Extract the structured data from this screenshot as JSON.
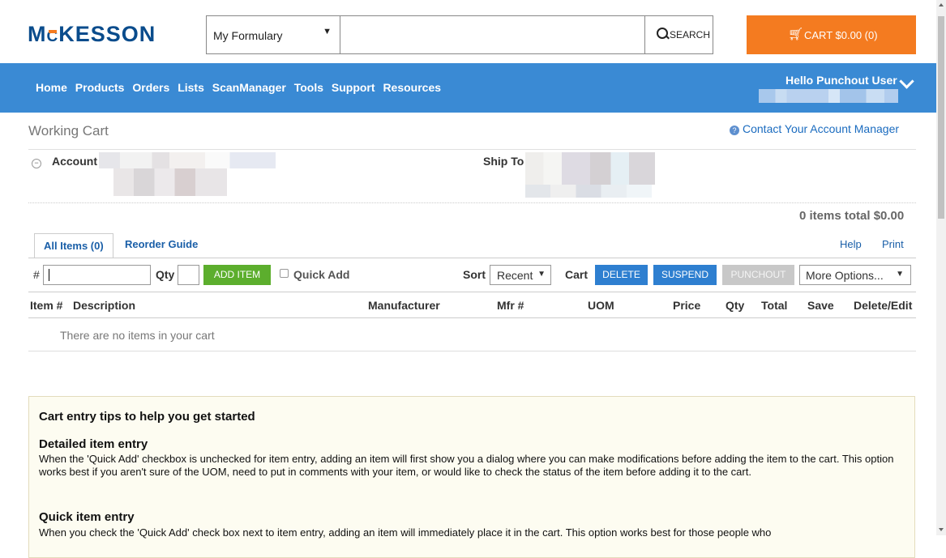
{
  "header": {
    "logo": "MCKESSON",
    "logo_parts": [
      "M",
      "C",
      "KESSON"
    ],
    "formulary_select": "My Formulary",
    "search_placeholder": "",
    "search_label": "SEARCH",
    "cart_label": "CART $0.00 (0)"
  },
  "nav": {
    "items": [
      "Home",
      "Products",
      "Orders",
      "Lists",
      "ScanManager",
      "Tools",
      "Support",
      "Resources"
    ],
    "greeting": "Hello Punchout User"
  },
  "page": {
    "title": "Working Cart",
    "contact_link": "Contact Your Account Manager",
    "account_label": "Account",
    "ship_to_label": "Ship To",
    "items_total": "0 items total $0.00"
  },
  "tabs": {
    "all_items": "All Items (0)",
    "reorder_guide": "Reorder Guide",
    "help": "Help",
    "print": "Print"
  },
  "toolbar": {
    "hash_label": "#",
    "qty_label": "Qty",
    "add_item": "ADD ITEM",
    "quick_add": "Quick Add",
    "sort_label": "Sort",
    "sort_value": "Recent",
    "cart_label": "Cart",
    "delete": "DELETE",
    "suspend": "SUSPEND",
    "punchout": "PUNCHOUT",
    "more_options": "More Options..."
  },
  "table": {
    "columns": [
      "Item #",
      "Description",
      "Manufacturer",
      "Mfr #",
      "UOM",
      "Price",
      "Qty",
      "Total",
      "Save",
      "Delete/Edit"
    ],
    "empty_message": "There are no items in your cart"
  },
  "tips": {
    "title": "Cart entry tips to help you get started",
    "detailed_heading": "Detailed item entry",
    "detailed_text": "When the 'Quick Add' checkbox is unchecked for item entry, adding an item will first show you a dialog where you can make modifications before adding the item to the cart. This option works best if you aren't sure of the UOM, need to put in comments with your item, or would like to check the status of the item before adding it to the cart.",
    "quick_heading": "Quick item entry",
    "quick_text": "When you check the 'Quick Add' check box next to item entry, adding an item will immediately place it in the cart. This option works best for those people who"
  },
  "colors": {
    "brand_blue": "#0a4c8c",
    "nav_blue": "#3a8ad4",
    "cart_orange": "#f47b20",
    "add_green": "#5cae2d",
    "action_blue": "#2e7fd0"
  }
}
